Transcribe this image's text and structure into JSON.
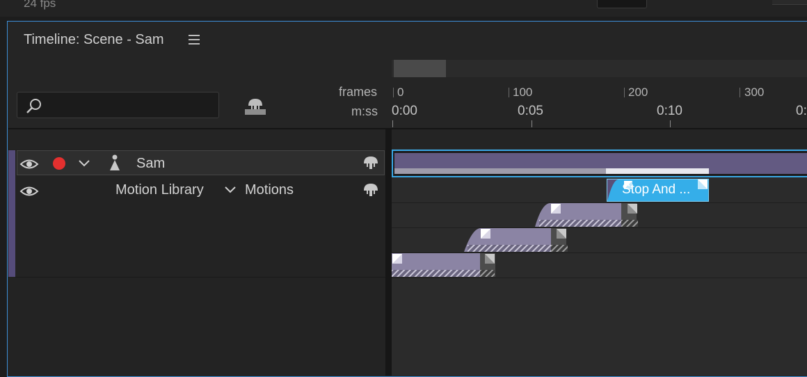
{
  "top": {
    "fps": "24 fps"
  },
  "panel": {
    "title": "Timeline: Scene - Sam"
  },
  "search": {
    "placeholder": ""
  },
  "ruler": {
    "frames_label": "frames",
    "time_label": "m:ss",
    "frame_marks": [
      "0",
      "100",
      "200",
      "300"
    ],
    "time_marks": [
      "0:00",
      "0:05",
      "0:10",
      "0:"
    ]
  },
  "layers": {
    "sam": {
      "name": "Sam"
    },
    "motion": {
      "library_label": "Motion Library",
      "motions_label": "Motions"
    }
  },
  "clips": {
    "stop": {
      "label": "Stop And ..."
    }
  },
  "colors": {
    "accent": "#3d8fd8",
    "record": "#e4302f",
    "selected_clip": "#35aee9",
    "clip": "#8b84a4",
    "track_bar": "#635a82"
  },
  "icons": [
    "search-icon",
    "puppet-icon",
    "eye-icon",
    "chevron-down-icon",
    "person-icon",
    "hamburger-menu-icon"
  ]
}
